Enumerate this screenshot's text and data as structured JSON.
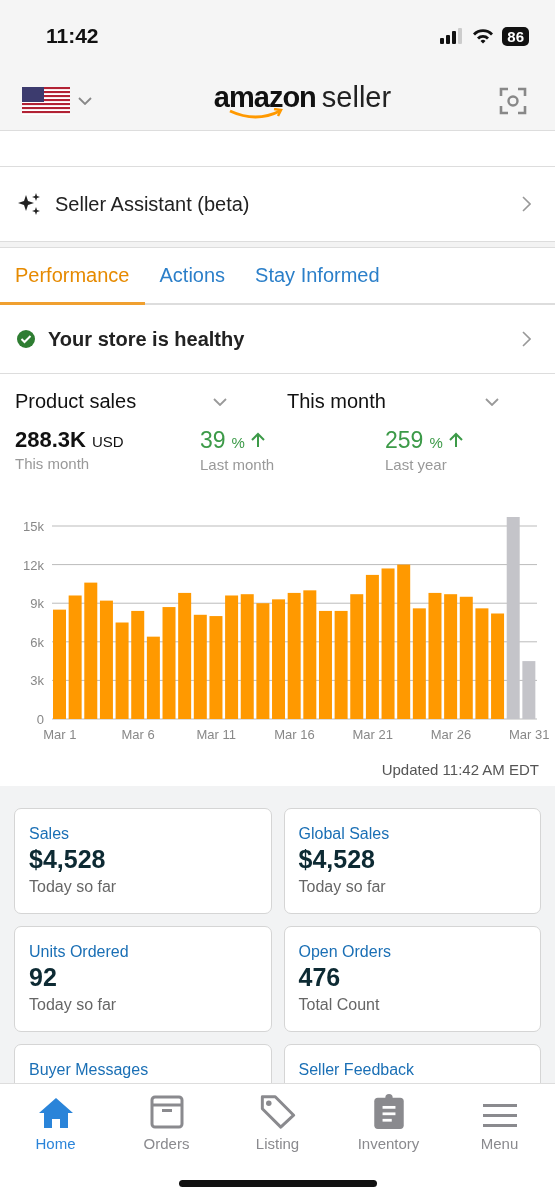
{
  "status_bar": {
    "time": "11:42",
    "battery": "86"
  },
  "header": {
    "logo_bold": "amazon",
    "logo_light": "seller"
  },
  "assistant": {
    "label": "Seller Assistant (beta)"
  },
  "tabs": [
    {
      "label": "Performance",
      "selected": true
    },
    {
      "label": "Actions",
      "selected": false
    },
    {
      "label": "Stay Informed",
      "selected": false
    }
  ],
  "health": {
    "label": "Your store is healthy",
    "healthy": true
  },
  "metrics": {
    "metric_select": "Product sales",
    "period_select": "This month",
    "total": {
      "value": "288.3K",
      "unit": "USD",
      "caption": "This month"
    },
    "changes": [
      {
        "value": "39",
        "unit": "%",
        "caption": "Last month"
      },
      {
        "value": "259",
        "unit": "%",
        "caption": "Last year"
      }
    ]
  },
  "chart_data": {
    "type": "bar",
    "categories": [
      "Mar 1",
      null,
      null,
      null,
      null,
      "Mar 6",
      null,
      null,
      null,
      null,
      "Mar 11",
      null,
      null,
      null,
      null,
      "Mar 16",
      null,
      null,
      null,
      null,
      "Mar 21",
      null,
      null,
      null,
      null,
      "Mar 26",
      null,
      null,
      null,
      null,
      "Mar 31"
    ],
    "series": [
      {
        "color": "#ff9900",
        "values": [
          8500,
          9600,
          10600,
          9200,
          7500,
          8400,
          6400,
          8700,
          9800,
          8100,
          8000,
          9600,
          9700,
          9000,
          9300,
          9800,
          10000,
          8400,
          8400,
          9700,
          11200,
          11700,
          12000,
          8600,
          9800,
          9700,
          9500,
          8600,
          8200,
          null,
          null
        ]
      },
      {
        "color": "#c4c4c9",
        "values": [
          null,
          null,
          null,
          null,
          null,
          null,
          null,
          null,
          null,
          null,
          null,
          null,
          null,
          null,
          null,
          null,
          null,
          null,
          null,
          null,
          null,
          null,
          null,
          null,
          null,
          null,
          null,
          null,
          null,
          15700,
          4500
        ]
      }
    ],
    "grid": true,
    "ylim": [
      0,
      15700
    ],
    "yticks": [
      {
        "value": 0,
        "label": "0"
      },
      {
        "value": 3000,
        "label": "3k"
      },
      {
        "value": 6000,
        "label": "6k"
      },
      {
        "value": 9000,
        "label": "9k"
      },
      {
        "value": 12000,
        "label": "12k"
      },
      {
        "value": 15000,
        "label": "15k"
      }
    ]
  },
  "updated": "Updated 11:42 AM EDT",
  "cards": [
    {
      "title": "Sales",
      "value": "$4,528",
      "caption": "Today so far"
    },
    {
      "title": "Global Sales",
      "value": "$4,528",
      "caption": "Today so far"
    },
    {
      "title": "Units Ordered",
      "value": "92",
      "caption": "Today so far"
    },
    {
      "title": "Open Orders",
      "value": "476",
      "caption": "Total Count"
    },
    {
      "title": "Buyer Messages"
    },
    {
      "title": "Seller Feedback"
    }
  ],
  "nav": [
    {
      "label": "Home",
      "kind": "home",
      "selected": true
    },
    {
      "label": "Orders",
      "kind": "orders",
      "selected": false
    },
    {
      "label": "Listing",
      "kind": "listing",
      "selected": false
    },
    {
      "label": "Inventory",
      "kind": "inventory",
      "selected": false
    },
    {
      "label": "Menu",
      "kind": "menu",
      "selected": false
    }
  ]
}
